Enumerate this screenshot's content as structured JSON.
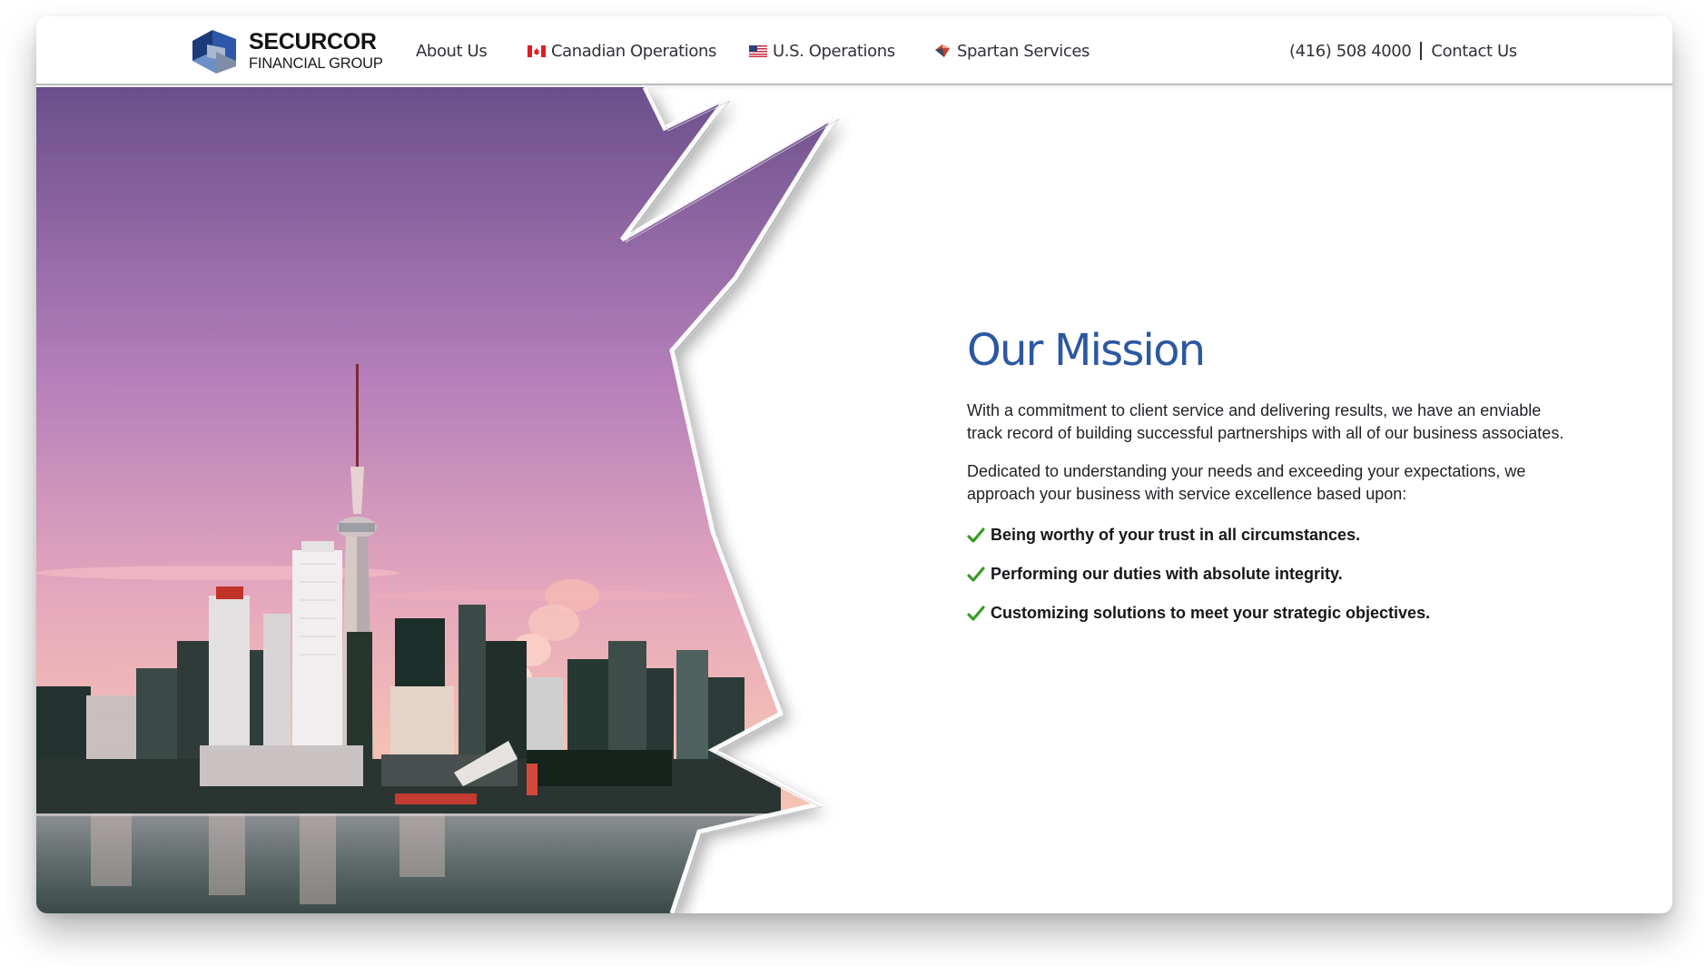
{
  "brand": {
    "name": "SECURCOR",
    "subtitle": "FINANCIAL GROUP"
  },
  "nav": {
    "items": [
      {
        "label": "About Us",
        "icon": null
      },
      {
        "label": "Canadian Operations",
        "icon": "canada-flag-icon"
      },
      {
        "label": "U.S. Operations",
        "icon": "us-flag-icon"
      },
      {
        "label": "Spartan Services",
        "icon": "spartan-shield-icon"
      }
    ]
  },
  "contact": {
    "phone": "(416) 508 4000",
    "link": "Contact Us"
  },
  "mission": {
    "title": "Our Mission",
    "paragraphs": [
      "With a commitment to client service and delivering results, we have an enviable track record of building successful partnerships with all of our business associates.",
      "Dedicated to understanding your needs and exceeding your expectations, we approach your business with service excellence based upon:"
    ],
    "points": [
      "Being worthy of your trust in all circumstances.",
      "Performing our duties with absolute integrity.",
      "Customizing solutions to meet your strategic objectives."
    ]
  },
  "colors": {
    "accent_blue": "#2c58a2",
    "check_green": "#3a9b2a",
    "sky_top": "#6b4f8c",
    "sky_bottom": "#f2b7b6"
  }
}
